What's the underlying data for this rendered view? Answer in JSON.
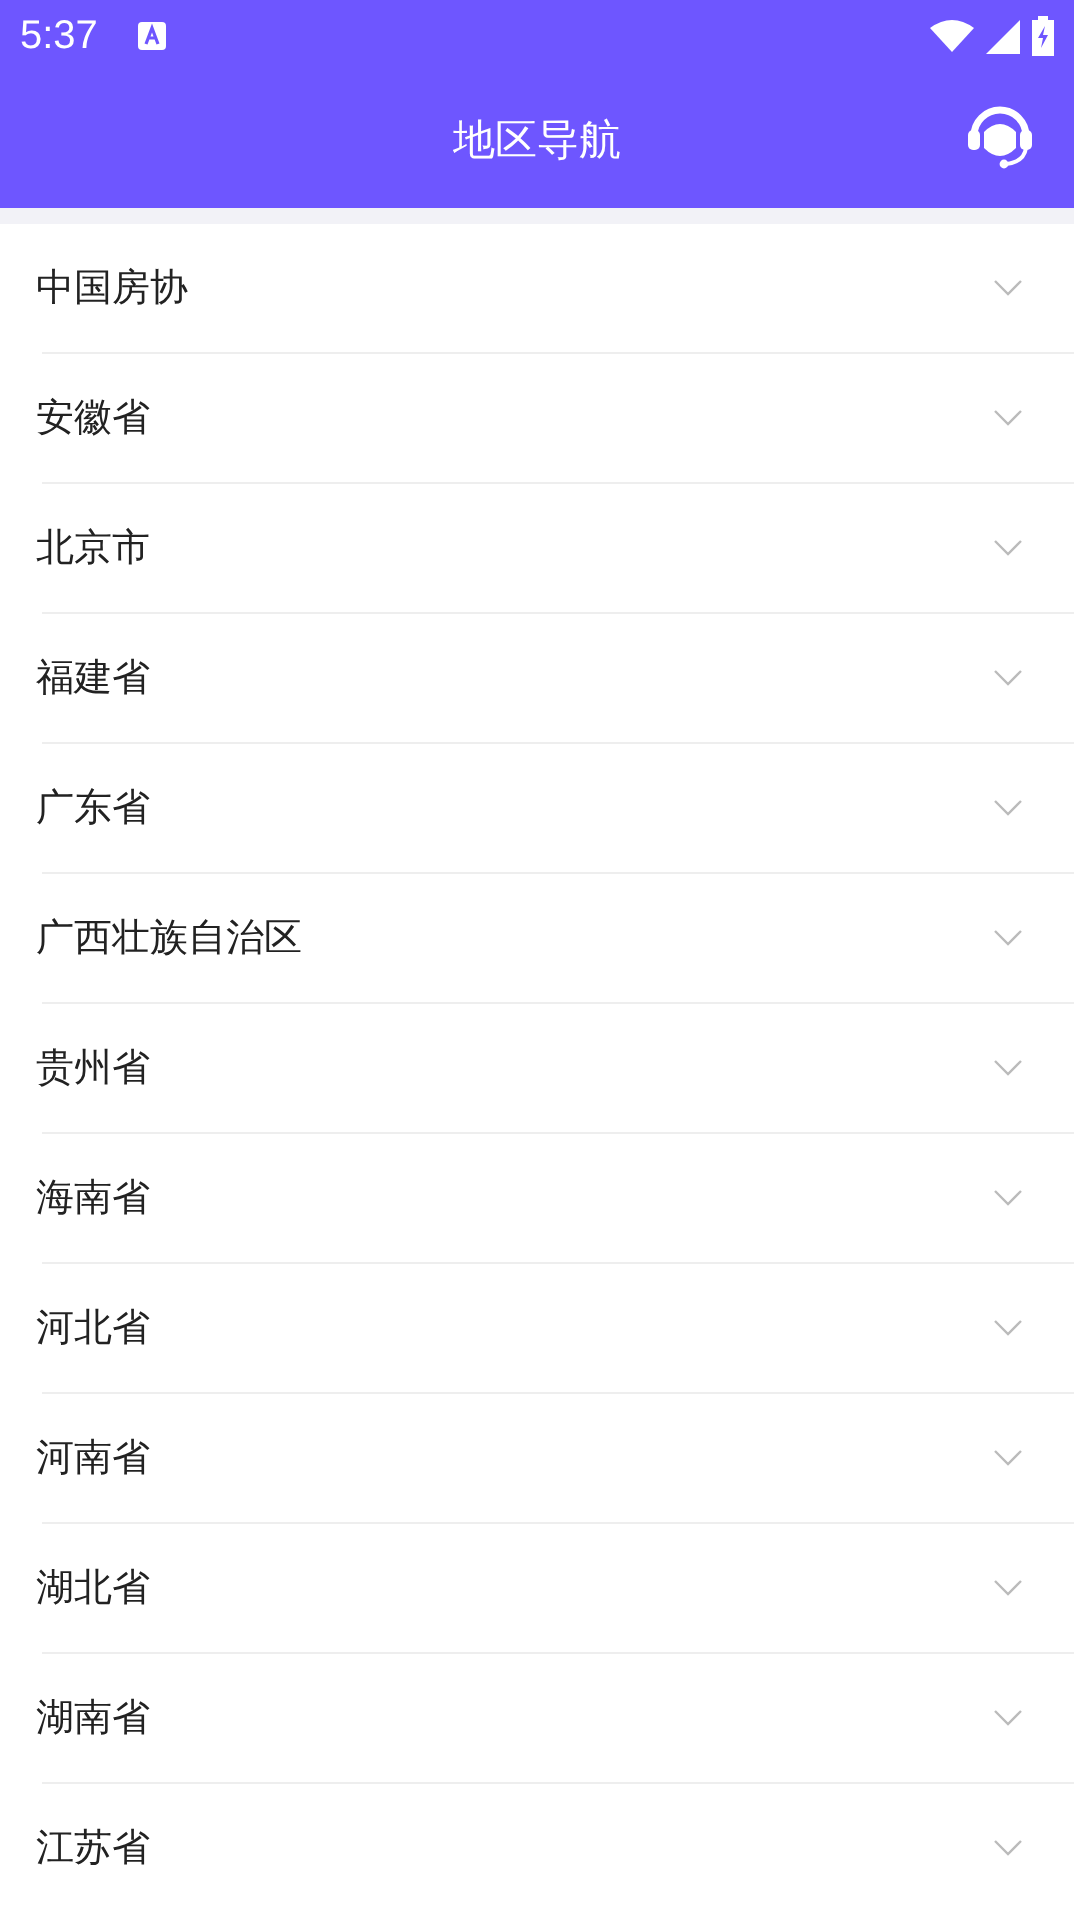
{
  "status_bar": {
    "time": "5:37"
  },
  "header": {
    "title": "地区导航"
  },
  "regions": [
    {
      "name": "中国房协",
      "expanded": false
    },
    {
      "name": "安徽省",
      "expanded": false
    },
    {
      "name": "北京市",
      "expanded": false
    },
    {
      "name": "福建省",
      "expanded": false
    },
    {
      "name": "广东省",
      "expanded": false
    },
    {
      "name": "广西壮族自治区",
      "expanded": false
    },
    {
      "name": "贵州省",
      "expanded": false
    },
    {
      "name": "海南省",
      "expanded": false
    },
    {
      "name": "河北省",
      "expanded": false
    },
    {
      "name": "河南省",
      "expanded": false
    },
    {
      "name": "湖北省",
      "expanded": false
    },
    {
      "name": "湖南省",
      "expanded": false
    },
    {
      "name": "江苏省",
      "expanded": false
    }
  ]
}
